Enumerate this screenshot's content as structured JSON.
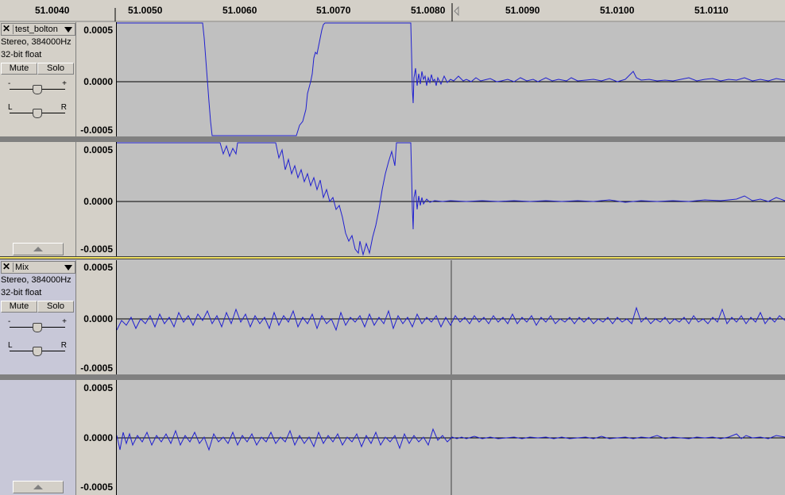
{
  "ruler": {
    "labels": [
      "51.0040",
      "51.0050",
      "51.0060",
      "51.0070",
      "51.0080",
      "51.0090",
      "51.0100",
      "51.0110"
    ]
  },
  "tracks": [
    {
      "name": "test_bolton",
      "format": "Stereo, 384000Hz",
      "bits": "32-bit float",
      "mute_label": "Mute",
      "solo_label": "Solo",
      "gain_minus": "-",
      "gain_plus": "+",
      "pan_left": "L",
      "pan_right": "R",
      "channels": [
        {
          "top": "0.0005",
          "mid": "0.0000",
          "bottom": "-0.0005"
        },
        {
          "top": "0.0005",
          "mid": "0.0000",
          "bottom": "-0.0005"
        }
      ]
    },
    {
      "name": "Mix",
      "format": "Stereo, 384000Hz",
      "bits": "32-bit float",
      "mute_label": "Mute",
      "solo_label": "Solo",
      "gain_minus": "-",
      "gain_plus": "+",
      "pan_left": "L",
      "pan_right": "R",
      "channels": [
        {
          "top": "0.0005",
          "mid": "0.0000",
          "bottom": "-0.0005"
        },
        {
          "top": "0.0005",
          "mid": "0.0000",
          "bottom": "-0.0005"
        }
      ]
    }
  ],
  "colors": {
    "waveform": "#2020d0",
    "background": "#c0c0c0",
    "panel": "#d4d0c8"
  }
}
